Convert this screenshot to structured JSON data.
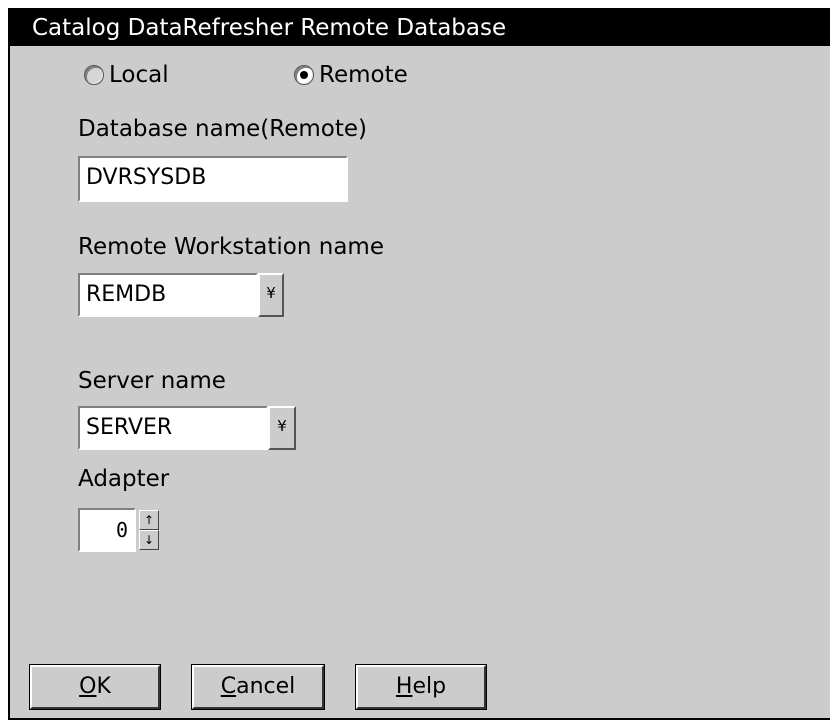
{
  "window": {
    "title": "Catalog DataRefresher Remote Database"
  },
  "location": {
    "options": [
      {
        "label": "Local",
        "selected": false
      },
      {
        "label": "Remote",
        "selected": true
      }
    ]
  },
  "database": {
    "label": "Database name(Remote)",
    "value": "DVRSYSDB"
  },
  "workstation": {
    "label": "Remote Workstation name",
    "value": "REMDB",
    "dropdown_glyph": "¥"
  },
  "server": {
    "label": "Server name",
    "value": "SERVER",
    "dropdown_glyph": "¥"
  },
  "adapter": {
    "label": "Adapter",
    "value": "0",
    "up_glyph": "↑",
    "down_glyph": "↓"
  },
  "buttons": {
    "ok": {
      "mnemonic": "O",
      "rest": "K"
    },
    "cancel": {
      "mnemonic": "C",
      "rest": "ancel"
    },
    "help": {
      "mnemonic": "H",
      "rest": "elp"
    }
  }
}
